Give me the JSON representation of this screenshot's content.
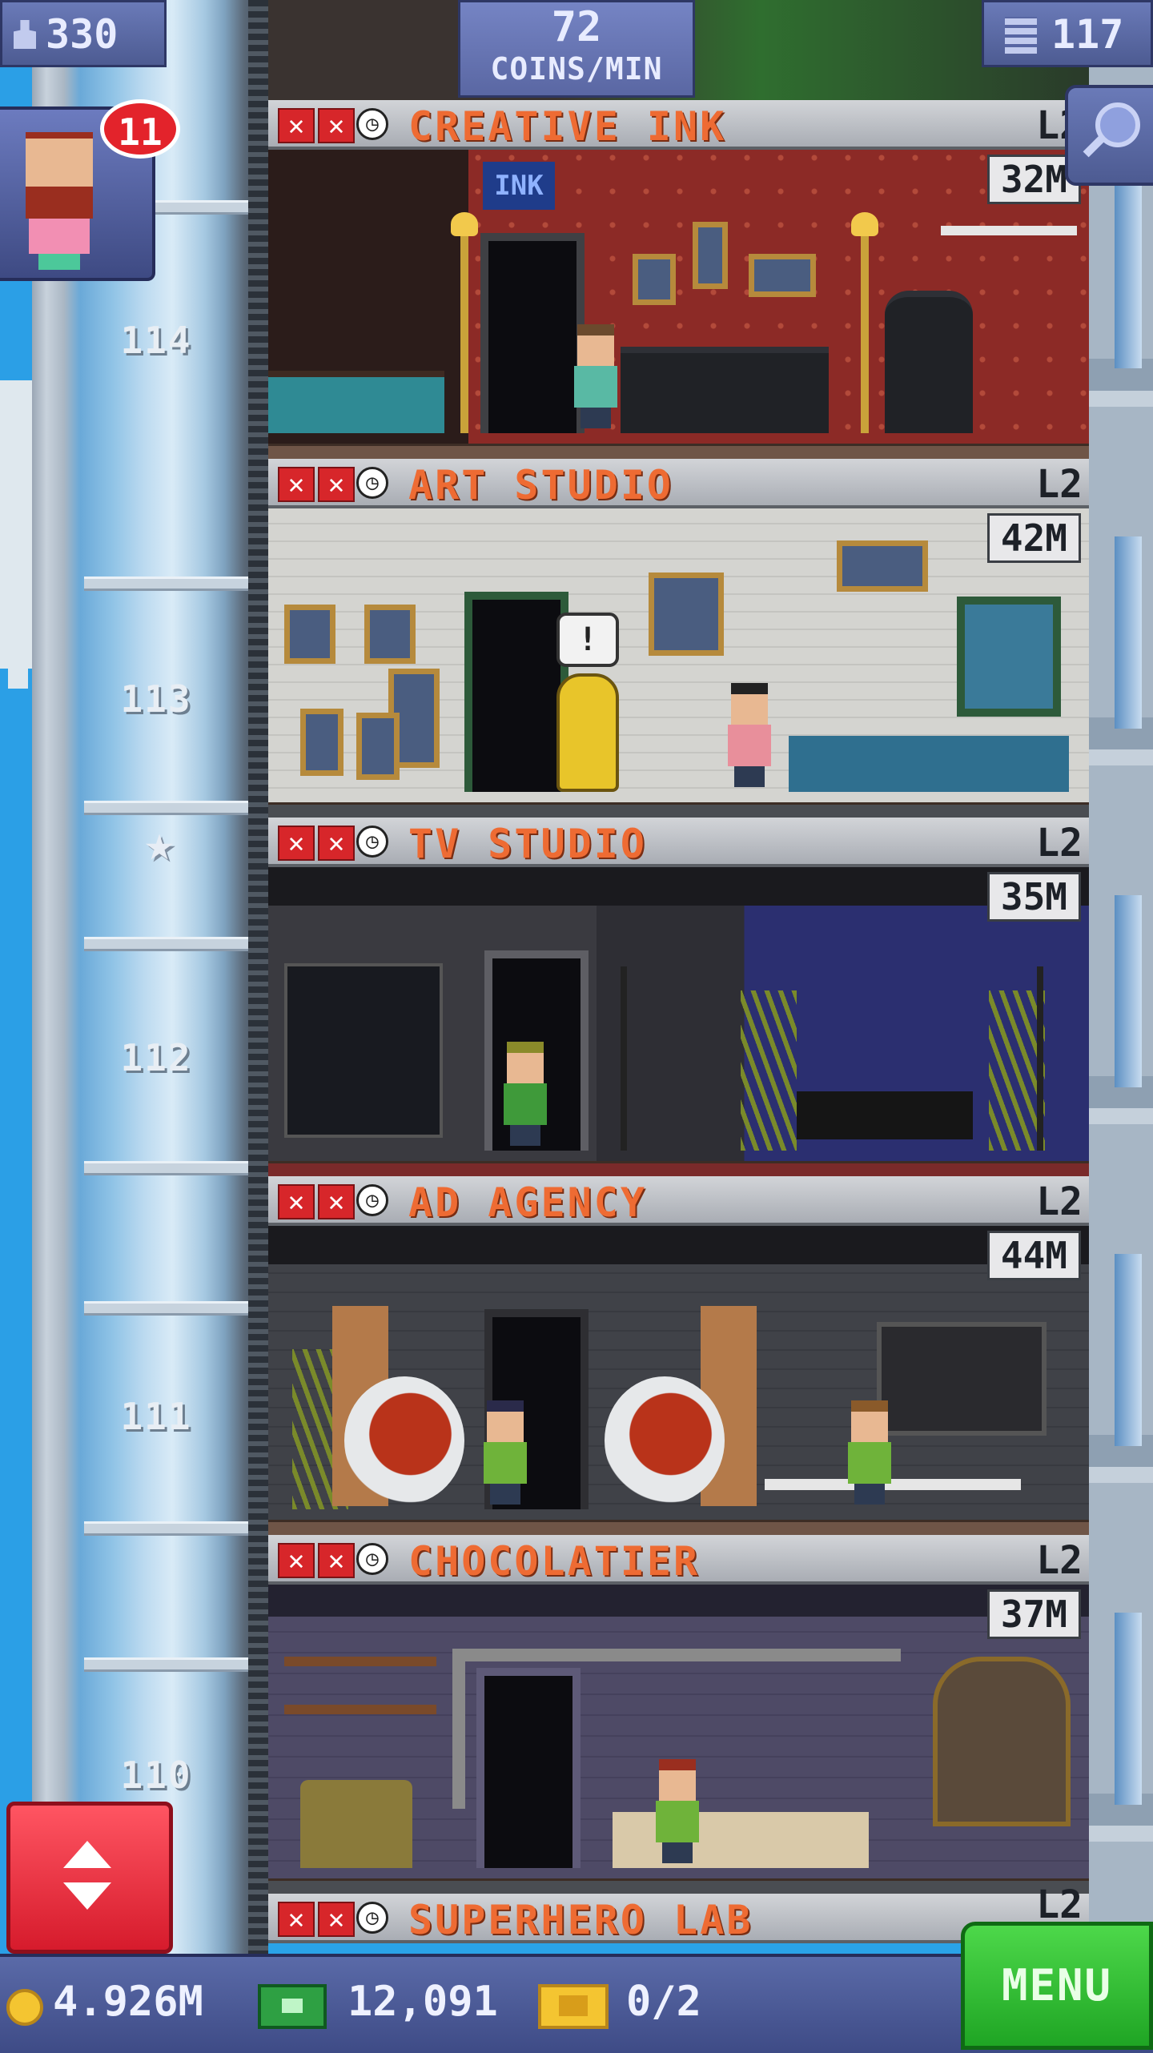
{
  "hud": {
    "population": "330",
    "coins_per_min_value": "72",
    "coins_per_min_label": "COINS/MIN",
    "floor_count": "117",
    "notification_count": "11"
  },
  "shaft": {
    "floor_numbers": [
      "114",
      "113",
      "112",
      "111",
      "110"
    ]
  },
  "floors": [
    {
      "name": "CREATIVE INK",
      "level": "L2",
      "value": "32M"
    },
    {
      "name": "ART STUDIO",
      "level": "L2",
      "value": "42M"
    },
    {
      "name": "TV STUDIO",
      "level": "L2",
      "value": "35M"
    },
    {
      "name": "AD AGENCY",
      "level": "L2",
      "value": "44M"
    },
    {
      "name": "CHOCOLATIER",
      "level": "L2",
      "value": "37M"
    },
    {
      "name": "SUPERHERO LAB",
      "level": "L2",
      "value": ""
    }
  ],
  "sign_text": "INK",
  "bottom_bar": {
    "coins": "4.926M",
    "bux": "12,091",
    "tickets": "0/2",
    "menu_label": "MENU"
  },
  "colors": {
    "floor_name": "#ee6b33",
    "menu_green": "#2fb82f",
    "elevator_red": "#e8283a",
    "hud_blue": "#5a67a3"
  },
  "icons": [
    "population-icon",
    "floors-icon",
    "zoom-icon",
    "elevator-arrows-icon",
    "coin-icon",
    "bux-icon",
    "ticket-icon",
    "x-icon",
    "clock-icon",
    "star-icon"
  ]
}
